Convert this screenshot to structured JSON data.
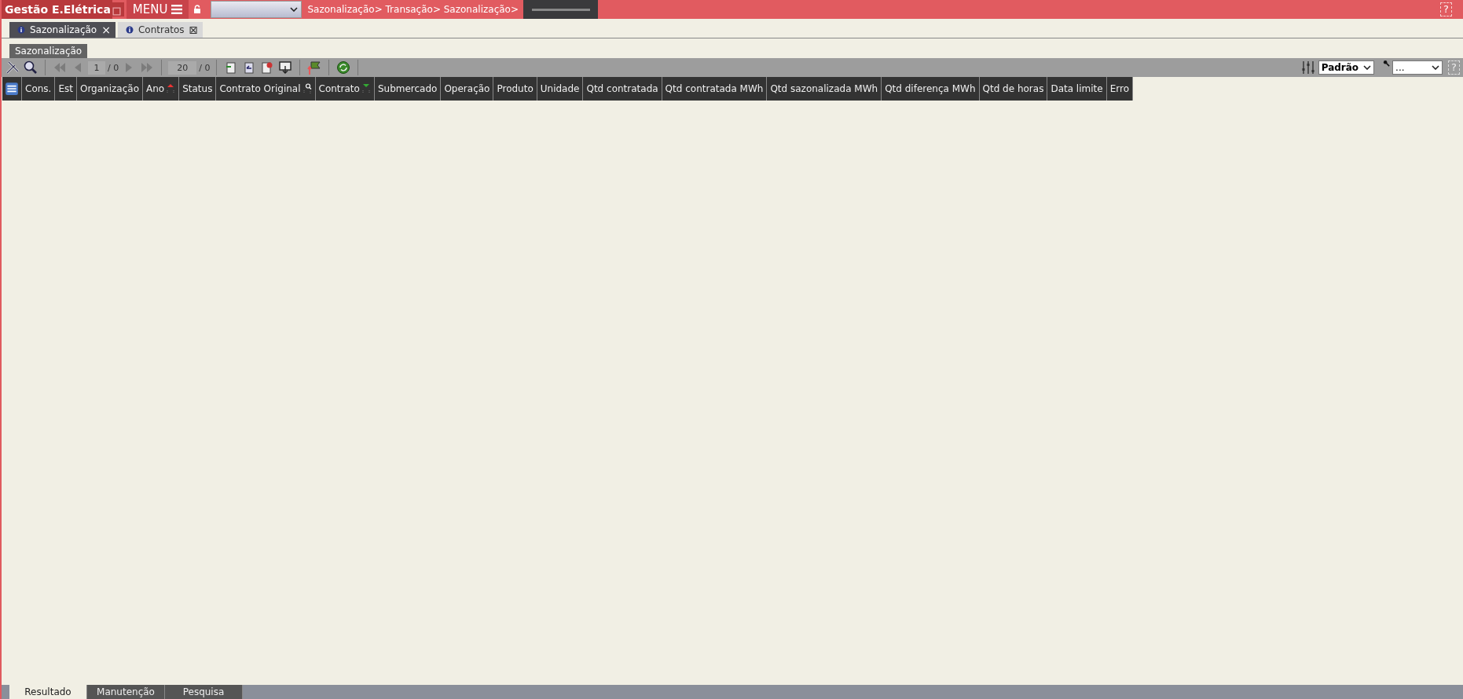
{
  "top_bar": {
    "title": "Gestão E.Elétrica",
    "menu_label": "MENU",
    "breadcrumb": "Sazonalização> Transação> Sazonalização>",
    "help": "?"
  },
  "tabs": [
    {
      "label": "Sazonalização",
      "selected": true,
      "close": "×"
    },
    {
      "label": "Contratos",
      "selected": false,
      "close": "⊠"
    }
  ],
  "subtabs": [
    {
      "label": "Sazonalização",
      "selected": true
    }
  ],
  "toolbar": {
    "page": "1",
    "page_total": "/ 0",
    "page_size": "20",
    "size_total": "/ 0",
    "nav_disabled": true,
    "view_select": "Padrão",
    "filter_select": "...",
    "help": "?"
  },
  "table": {
    "columns": [
      {
        "label": "Cons."
      },
      {
        "label": "Est"
      },
      {
        "label": "Organização"
      },
      {
        "label": "Ano",
        "sorted_ascending": true
      },
      {
        "label": "Status"
      },
      {
        "label": "Contrato Original",
        "filter": true
      },
      {
        "label": "Contrato",
        "sorted_descending": true
      },
      {
        "label": "Submercado"
      },
      {
        "label": "Operação"
      },
      {
        "label": "Produto"
      },
      {
        "label": "Unidade"
      },
      {
        "label": "Qtd contratada"
      },
      {
        "label": "Qtd contratada MWh"
      },
      {
        "label": "Qtd sazonalizada MWh"
      },
      {
        "label": "Qtd diferença MWh"
      },
      {
        "label": "Qtd de horas"
      },
      {
        "label": "Data limite"
      },
      {
        "label": "Erro"
      }
    ]
  },
  "bottom_tabs": [
    {
      "label": "Resultado",
      "selected": true
    },
    {
      "label": "Manutenção",
      "selected": false
    },
    {
      "label": "Pesquisa",
      "selected": false
    }
  ]
}
